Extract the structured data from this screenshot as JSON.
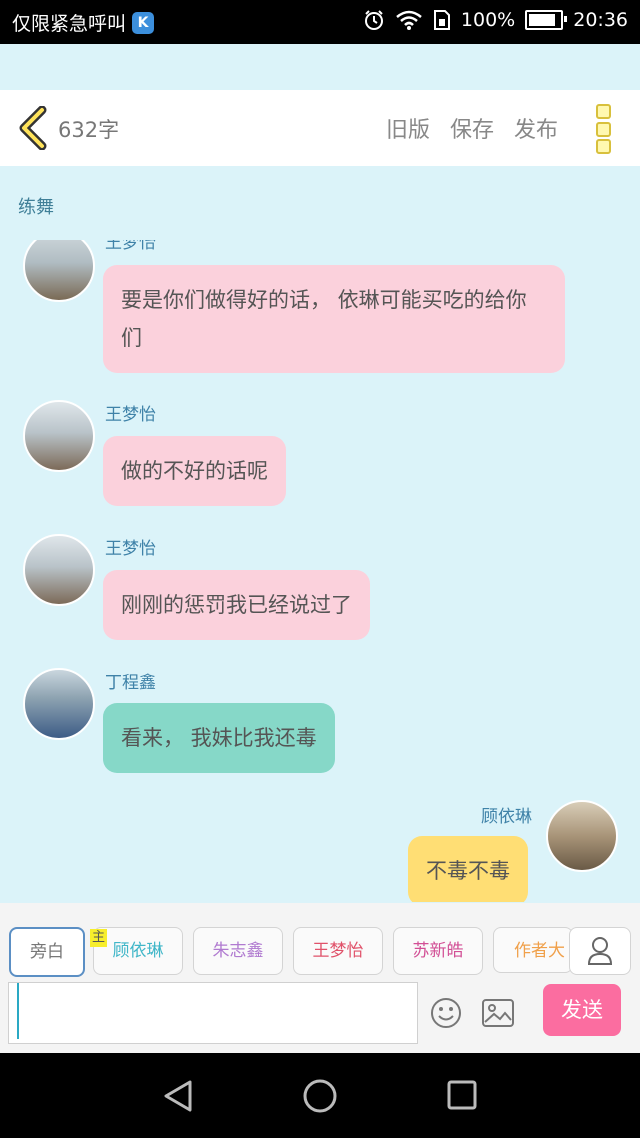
{
  "status_bar": {
    "carrier": "仅限紧急呼叫",
    "app_badge": "K",
    "battery": "100%",
    "battery_level": 1.0,
    "time": "20:36",
    "icons": [
      "alarm-icon",
      "wifi-icon",
      "sim-icon",
      "battery-icon"
    ]
  },
  "toolbar": {
    "word_count": "632字",
    "old_version": "旧版",
    "save": "保存",
    "publish": "发布"
  },
  "chapter_title": "练舞",
  "messages": [
    {
      "speaker": "王梦怡",
      "text": "要是你们做得好的话， 依琳可能买吃的给你们",
      "side": "left",
      "color": "pink"
    },
    {
      "speaker": "王梦怡",
      "text": "做的不好的话呢",
      "side": "left",
      "color": "pink"
    },
    {
      "speaker": "王梦怡",
      "text": "刚刚的惩罚我已经说过了",
      "side": "left",
      "color": "pink"
    },
    {
      "speaker": "丁程鑫",
      "text": "看来， 我妹比我还毒",
      "side": "left",
      "color": "teal"
    },
    {
      "speaker": "顾依琳",
      "text": "不毒不毒",
      "side": "right",
      "color": "yellow"
    }
  ],
  "roles": {
    "narration": "旁白",
    "lead_tag": "主",
    "characters": [
      {
        "name": "顾依琳",
        "color": "#3fb6c8"
      },
      {
        "name": "朱志鑫",
        "color": "#b07ad0"
      },
      {
        "name": "王梦怡",
        "color": "#e0526a"
      },
      {
        "name": "苏新皓",
        "color": "#d24f95"
      },
      {
        "name": "作者大",
        "color": "#f0a04a"
      }
    ]
  },
  "input": {
    "value": "",
    "placeholder": "",
    "send": "发送"
  },
  "nav": [
    "back-icon",
    "home-icon",
    "recents-icon"
  ]
}
